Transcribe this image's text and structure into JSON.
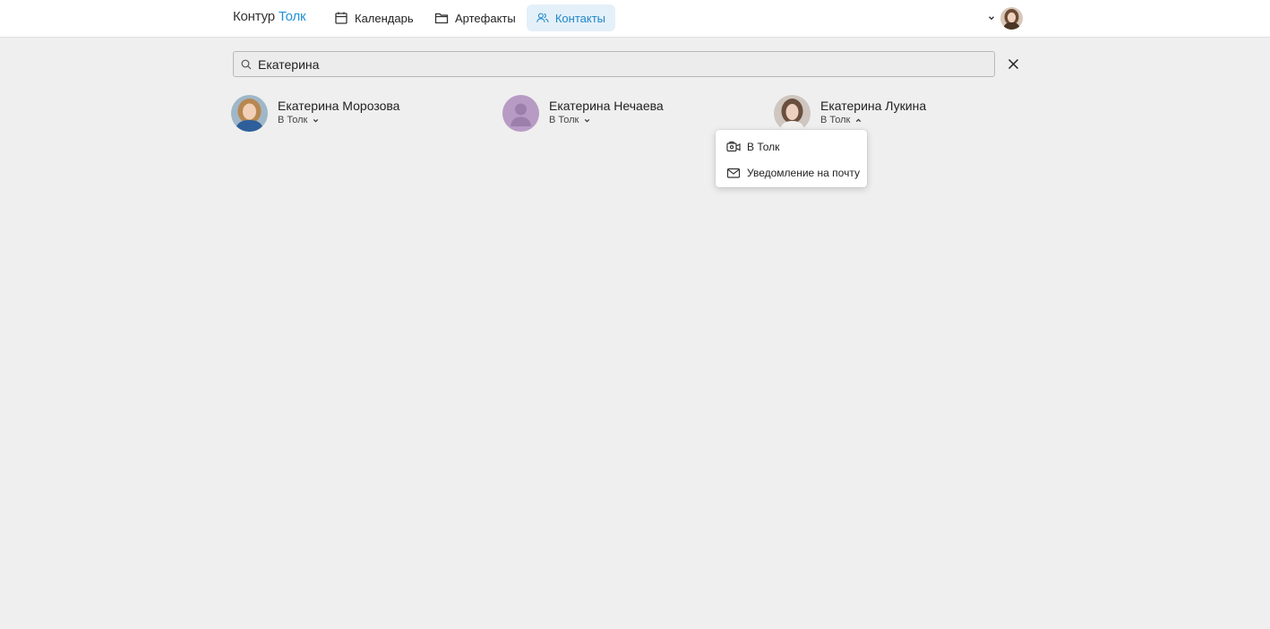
{
  "app": {
    "logo_part1": "Контур",
    "logo_part2": "Толк"
  },
  "nav": {
    "calendar": "Календарь",
    "artifacts": "Артефакты",
    "contacts": "Контакты"
  },
  "search": {
    "value": "Екатерина"
  },
  "contacts": [
    {
      "name": "Екатерина Морозова",
      "action": "В Толк"
    },
    {
      "name": "Екатерина Нечаева",
      "action": "В Толк"
    },
    {
      "name": "Екатерина Лукина",
      "action": "В Толк"
    }
  ],
  "dropdown": {
    "items": [
      {
        "label": "В Толк",
        "icon": "video-camera-icon"
      },
      {
        "label": "Уведомление на почту",
        "icon": "mail-icon"
      }
    ]
  },
  "colors": {
    "accent": "#2291d6",
    "active_nav_bg": "#e4f0f9",
    "page_bg": "#efefef",
    "placeholder_avatar": "#b79bc4"
  }
}
